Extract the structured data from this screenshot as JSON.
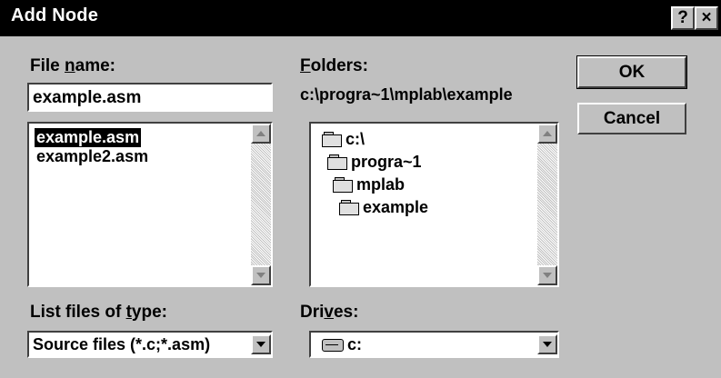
{
  "dialog": {
    "title": "Add Node",
    "help_label": "?",
    "close_label": "×"
  },
  "file_name": {
    "label_pre": "File ",
    "label_mnemonic": "n",
    "label_post": "ame:",
    "value": "example.asm",
    "files": [
      "example.asm",
      "example2.asm"
    ]
  },
  "folders": {
    "label_mnemonic": "F",
    "label_post": "olders:",
    "current_path": "c:\\progra~1\\mplab\\example",
    "tree": [
      "c:\\",
      "progra~1",
      "mplab",
      "example"
    ]
  },
  "buttons": {
    "ok": "OK",
    "cancel": "Cancel"
  },
  "file_type": {
    "label_pre": "List files of ",
    "label_mnemonic": "t",
    "label_post": "ype:",
    "selected": "Source files (*.c;*.asm)"
  },
  "drives": {
    "label_pre": "Dri",
    "label_mnemonic": "v",
    "label_post": "es:",
    "selected": "c:"
  },
  "icons": {
    "folder": "folder-icon",
    "drive": "drive-icon",
    "dropdown": "chevron-down-icon",
    "scroll_up": "scroll-up-arrow-icon",
    "scroll_down": "scroll-down-arrow-icon"
  }
}
